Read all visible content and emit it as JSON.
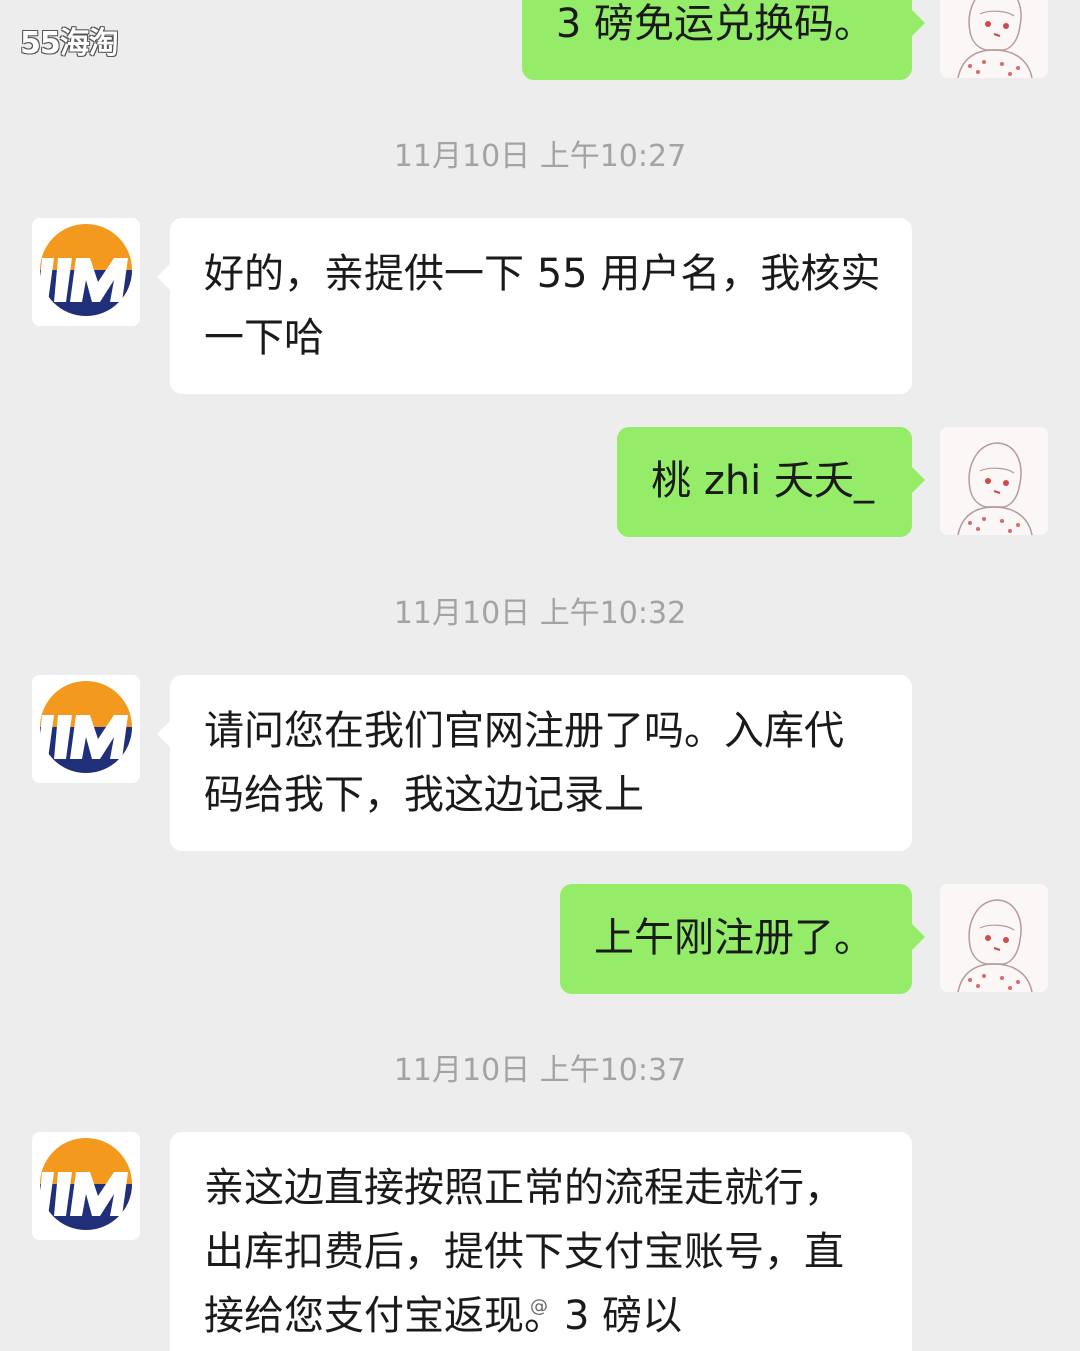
{
  "watermark": "55海淘",
  "messages": [
    {
      "kind": "out",
      "text": "3 磅免运兑换码。"
    },
    {
      "kind": "time",
      "text": "11月10日 上午10:27"
    },
    {
      "kind": "in",
      "text": "好的，亲提供一下 55 用户名，我核实一下哈"
    },
    {
      "kind": "out",
      "text": "桃 zhi 夭夭_"
    },
    {
      "kind": "time",
      "text": "11月10日 上午10:32"
    },
    {
      "kind": "in",
      "text": "请问您在我们官网注册了吗。入库代码给我下，我这边记录上"
    },
    {
      "kind": "out",
      "text": "上午刚注册了。"
    },
    {
      "kind": "time",
      "text": "11月10日 上午10:37"
    },
    {
      "kind": "in",
      "text": "亲这边直接按照正常的流程走就行，出库扣费后，提供下支付宝账号，直接给您支付宝返现。3 磅以"
    }
  ],
  "mark": "@",
  "colors": {
    "background": "#ededed",
    "outgoing_bubble": "#95ec69",
    "incoming_bubble": "#ffffff",
    "timestamp": "#a3a3a3",
    "logo_orange": "#f39a1e",
    "logo_navy": "#1f2f7a"
  },
  "icons": {
    "service_avatar": "tm-logo-icon",
    "user_avatar": "sketch-portrait-avatar"
  }
}
